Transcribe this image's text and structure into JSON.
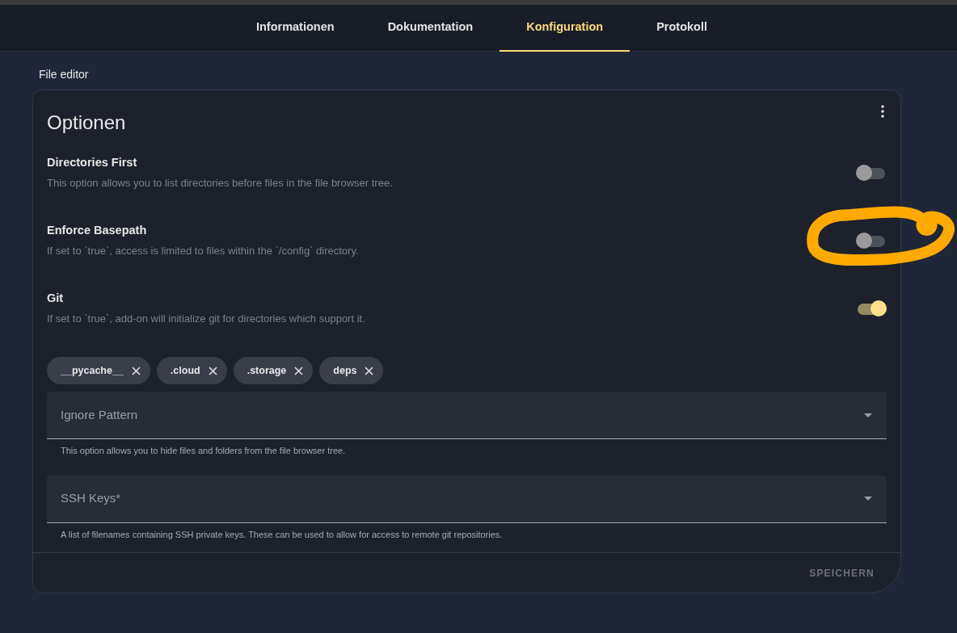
{
  "tabs": [
    {
      "label": "Informationen",
      "selected": false
    },
    {
      "label": "Dokumentation",
      "selected": false
    },
    {
      "label": "Konfiguration",
      "selected": true
    },
    {
      "label": "Protokoll",
      "selected": false
    }
  ],
  "section_title": "File editor",
  "card": {
    "title": "Optionen",
    "options": [
      {
        "title": "Directories First",
        "description": "This option allows you to list directories before files in the file browser tree.",
        "on": false
      },
      {
        "title": "Enforce Basepath",
        "description": "If set to `true`, access is limited to files within the `/config` directory.",
        "on": false
      },
      {
        "title": "Git",
        "description": "If set to `true`, add-on will initialize git for directories which support it.",
        "on": true
      }
    ],
    "chips": [
      "__pycache__",
      ".cloud",
      ".storage",
      "deps"
    ],
    "fields": [
      {
        "placeholder": "Ignore Pattern",
        "helper": "This option allows you to hide files and folders from the file browser tree."
      },
      {
        "placeholder": "SSH Keys*",
        "helper": "A list of filenames containing SSH private keys. These can be used to allow for access to remote git repositories."
      }
    ],
    "save_button": {
      "label": "SPEICHERN",
      "disabled": true
    }
  }
}
